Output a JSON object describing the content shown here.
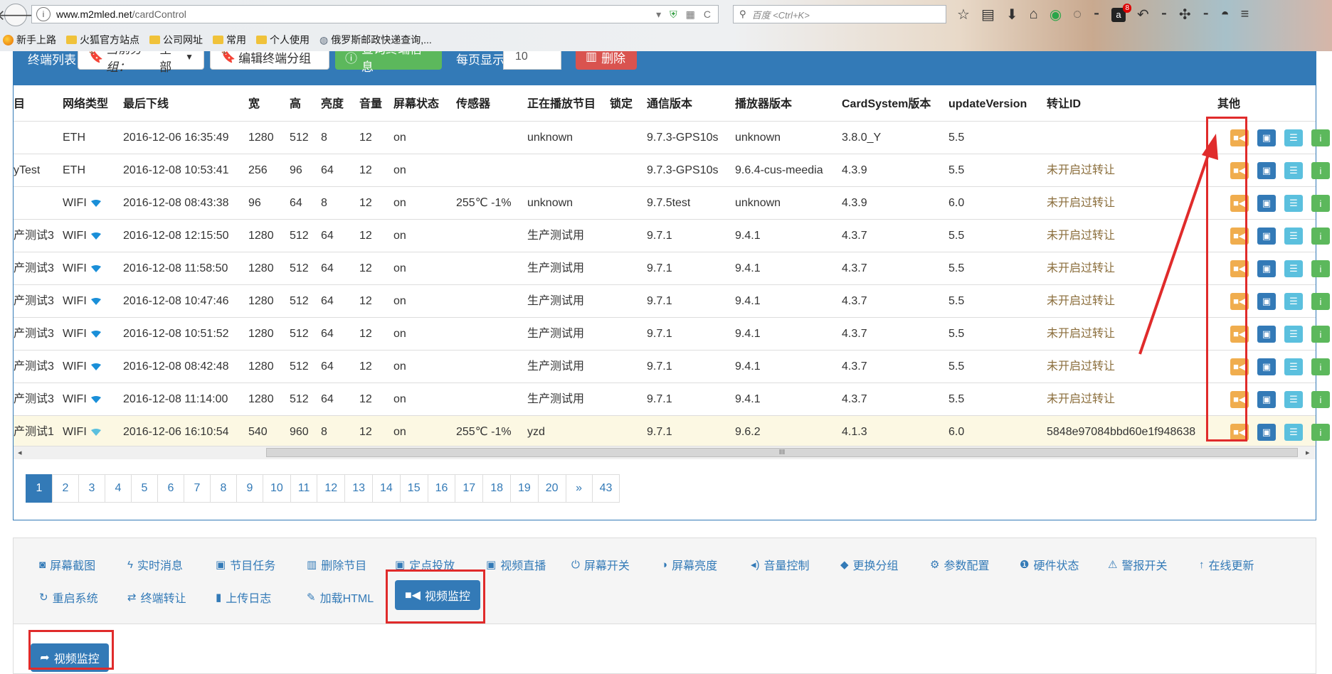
{
  "browser": {
    "url_host": "www.m2mled.net",
    "url_path": "/cardControl",
    "search_placeholder": "百度 <Ctrl+K>",
    "notification_count": "8",
    "bookmarks": [
      {
        "label": "新手上路",
        "icon": "firefox-icon"
      },
      {
        "label": "火狐官方站点",
        "icon": "folder-icon"
      },
      {
        "label": "公司网址",
        "icon": "folder-icon"
      },
      {
        "label": "常用",
        "icon": "folder-icon"
      },
      {
        "label": "个人使用",
        "icon": "folder-icon"
      },
      {
        "label": "俄罗斯邮政快递查询,...",
        "icon": "globe-icon"
      }
    ]
  },
  "panel": {
    "title": "终端列表",
    "group_prefix": "当前分组：",
    "group_value": "全部",
    "edit_group_label": "编辑终端分组",
    "query_label": "查询终端信息",
    "per_page_label": "每页显示",
    "per_page_value": "10",
    "delete_label": "删除"
  },
  "table": {
    "headers": [
      "目",
      "网络类型",
      "最后下线",
      "宽",
      "高",
      "亮度",
      "音量",
      "屏幕状态",
      "传感器",
      "正在播放节目",
      "锁定",
      "通信版本",
      "播放器版本",
      "CardSystem版本",
      "updateVersion",
      "转让ID",
      "其他"
    ],
    "rows": [
      [
        "",
        "ETH",
        "2016-12-06 16:35:49",
        "1280",
        "512",
        "8",
        "12",
        "on",
        "",
        "unknown",
        "",
        "9.7.3-GPS10s",
        "unknown",
        "3.8.0_Y",
        "5.5",
        ""
      ],
      [
        "yTest",
        "ETH",
        "2016-12-08 10:53:41",
        "256",
        "96",
        "64",
        "12",
        "on",
        "",
        "",
        "",
        "9.7.3-GPS10s",
        "9.6.4-cus-meedia",
        "4.3.9",
        "5.5",
        "未开启过转让"
      ],
      [
        "",
        "WIFI",
        "2016-12-08 08:43:38",
        "96",
        "64",
        "8",
        "12",
        "on",
        "255℃ -1%",
        "unknown",
        "",
        "9.7.5test",
        "unknown",
        "4.3.9",
        "6.0",
        "未开启过转让"
      ],
      [
        "产测试3",
        "WIFI",
        "2016-12-08 12:15:50",
        "1280",
        "512",
        "64",
        "12",
        "on",
        "",
        "生产测试用",
        "",
        "9.7.1",
        "9.4.1",
        "4.3.7",
        "5.5",
        "未开启过转让"
      ],
      [
        "产测试3",
        "WIFI",
        "2016-12-08 11:58:50",
        "1280",
        "512",
        "64",
        "12",
        "on",
        "",
        "生产测试用",
        "",
        "9.7.1",
        "9.4.1",
        "4.3.7",
        "5.5",
        "未开启过转让"
      ],
      [
        "产测试3",
        "WIFI",
        "2016-12-08 10:47:46",
        "1280",
        "512",
        "64",
        "12",
        "on",
        "",
        "生产测试用",
        "",
        "9.7.1",
        "9.4.1",
        "4.3.7",
        "5.5",
        "未开启过转让"
      ],
      [
        "产测试3",
        "WIFI",
        "2016-12-08 10:51:52",
        "1280",
        "512",
        "64",
        "12",
        "on",
        "",
        "生产测试用",
        "",
        "9.7.1",
        "9.4.1",
        "4.3.7",
        "5.5",
        "未开启过转让"
      ],
      [
        "产测试3",
        "WIFI",
        "2016-12-08 08:42:48",
        "1280",
        "512",
        "64",
        "12",
        "on",
        "",
        "生产测试用",
        "",
        "9.7.1",
        "9.4.1",
        "4.3.7",
        "5.5",
        "未开启过转让"
      ],
      [
        "产测试3",
        "WIFI",
        "2016-12-08 11:14:00",
        "1280",
        "512",
        "64",
        "12",
        "on",
        "",
        "生产测试用",
        "",
        "9.7.1",
        "9.4.1",
        "4.3.7",
        "5.5",
        "未开启过转让"
      ],
      [
        "产测试1",
        "WIFI",
        "2016-12-06 16:10:54",
        "540",
        "960",
        "8",
        "12",
        "on",
        "255℃ -1%",
        "yzd",
        "",
        "9.7.1",
        "9.6.2",
        "4.1.3",
        "6.0",
        "5848e97084bbd60e1f948638"
      ]
    ],
    "highlighted_row": 9,
    "scrollbar_grip": "III"
  },
  "pagination": [
    "1",
    "2",
    "3",
    "4",
    "5",
    "6",
    "7",
    "8",
    "9",
    "10",
    "11",
    "12",
    "13",
    "14",
    "15",
    "16",
    "17",
    "18",
    "19",
    "20",
    "»",
    "43"
  ],
  "functions": [
    {
      "label": "屏幕截图",
      "icon": "camera-icon"
    },
    {
      "label": "实时消息",
      "icon": "flash-icon"
    },
    {
      "label": "节目任务",
      "icon": "film-icon"
    },
    {
      "label": "删除节目",
      "icon": "trash-icon"
    },
    {
      "label": "定点投放",
      "icon": "film-icon"
    },
    {
      "label": "视频直播",
      "icon": "film-icon"
    },
    {
      "label": "屏幕开关",
      "icon": "power-icon"
    },
    {
      "label": "屏幕亮度",
      "icon": "adjust-icon"
    },
    {
      "label": "音量控制",
      "icon": "volume-icon"
    },
    {
      "label": "更换分组",
      "icon": "tag-icon"
    },
    {
      "label": "参数配置",
      "icon": "cog-icon"
    },
    {
      "label": "硬件状态",
      "icon": "info-icon"
    },
    {
      "label": "警报开关",
      "icon": "warning-icon"
    },
    {
      "label": "在线更新",
      "icon": "arrow-up-icon"
    },
    {
      "label": "重启系统",
      "icon": "refresh-icon"
    },
    {
      "label": "终端转让",
      "icon": "transfer-icon"
    },
    {
      "label": "上传日志",
      "icon": "file-icon"
    },
    {
      "label": "加载HTML",
      "icon": "pencil-icon"
    }
  ],
  "active_function": {
    "label": "视频监控",
    "icon": "video-camera-icon"
  },
  "action_button": {
    "label": "视频监控",
    "icon": "share-icon"
  },
  "colors": {
    "primary": "#337ab7",
    "warning": "#f0ad4e",
    "info": "#5bc0de",
    "success": "#5cb85c",
    "danger": "#d9534f",
    "annotation_red": "#e02b2b",
    "highlight_row": "#fcf8e3"
  }
}
